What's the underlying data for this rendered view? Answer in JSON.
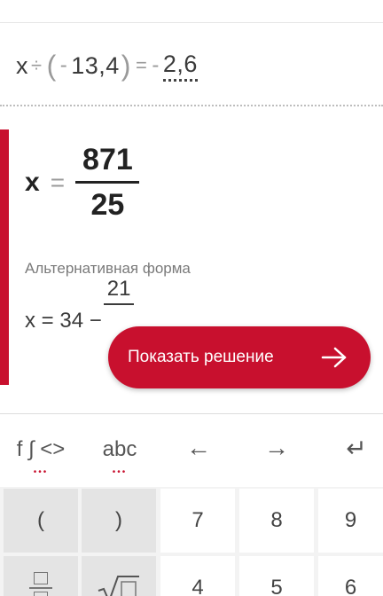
{
  "equation": {
    "x": "x",
    "divide": "÷",
    "open_paren": "(",
    "minus": "-",
    "divisor": "13,4",
    "close_paren": ")",
    "equals": "=",
    "rhs_minus": "-",
    "rhs_value": "2,6"
  },
  "result": {
    "variable": "x",
    "equals": "=",
    "numerator": "871",
    "denominator": "25"
  },
  "alternative": {
    "label": "Альтернативная форма",
    "prefix": "x = 34 −",
    "fraction_numerator": "21"
  },
  "show_solution_button": {
    "label": "Показать решение",
    "icon": "arrow-right-icon"
  },
  "keyboard": {
    "tabs": [
      {
        "label": "f ∫ <>",
        "dots": "•••"
      },
      {
        "label": "abc",
        "dots": "•••"
      }
    ],
    "nav": {
      "left": "←",
      "right": "→",
      "enter": "↵"
    },
    "row1": [
      "(",
      ")",
      "7",
      "8",
      "9"
    ],
    "row2": [
      "fraction-icon",
      "sqrt-icon",
      "4",
      "5",
      "6"
    ]
  },
  "colors": {
    "accent": "#c8102e",
    "text": "#444444",
    "muted": "#7a7a7a"
  }
}
